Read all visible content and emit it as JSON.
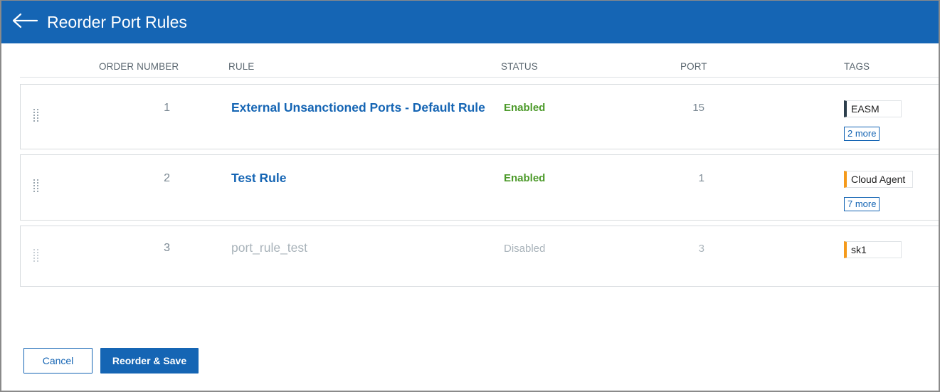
{
  "header": {
    "title": "Reorder Port Rules",
    "back_icon": "arrow-left-icon"
  },
  "columns": {
    "order_number": "ORDER NUMBER",
    "rule": "RULE",
    "status": "STATUS",
    "port": "PORT",
    "tags": "TAGS"
  },
  "rows": [
    {
      "order": "1",
      "rule": "External Unsanctioned Ports - Default Rule",
      "status": "Enabled",
      "port": "15",
      "tag": "EASM",
      "tag_color": "#2c3e4c",
      "more": "2 more"
    },
    {
      "order": "2",
      "rule": "Test Rule",
      "status": "Enabled",
      "port": "1",
      "tag": "Cloud Agent",
      "tag_color": "#f59a1b",
      "more": "7 more"
    },
    {
      "order": "3",
      "rule": "port_rule_test",
      "status": "Disabled",
      "port": "3",
      "tag": "sk1",
      "tag_color": "#f59a1b"
    }
  ],
  "footer": {
    "cancel_label": "Cancel",
    "save_label": "Reorder & Save"
  },
  "colors": {
    "primary": "#1565b4",
    "enabled": "#4c9a2a",
    "disabled": "#aab4bb"
  }
}
